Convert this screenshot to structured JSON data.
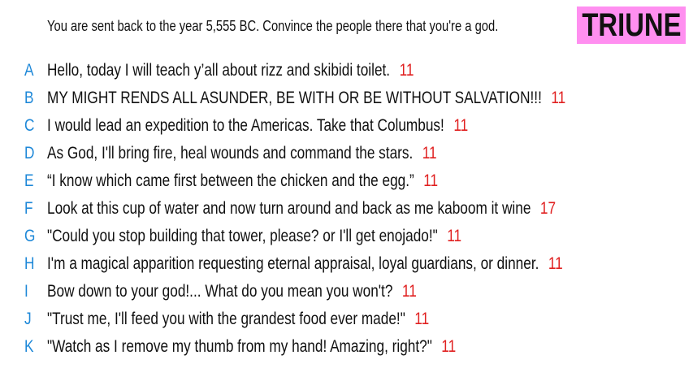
{
  "prompt": "You are sent back to the year 5,555 BC. Convince the people there that you're a god.",
  "badge": "TRIUNE",
  "colors": {
    "letter": "#1e88d8",
    "count": "#e02020",
    "badge_bg": "#ff8ff0"
  },
  "answers": [
    {
      "letter": "A",
      "text": "Hello, today I will teach y’all about rizz and skibidi toilet.",
      "count": "11"
    },
    {
      "letter": "B",
      "text": "MY MIGHT RENDS ALL ASUNDER, BE WITH OR BE WITHOUT SALVATION!!!",
      "count": "11"
    },
    {
      "letter": "C",
      "text": "I would lead an expedition to the Americas. Take that Columbus!",
      "count": "11"
    },
    {
      "letter": "D",
      "text": "As God, I'll bring fire, heal wounds and command the stars.",
      "count": "11"
    },
    {
      "letter": "E",
      "text": "“I know which came first between the chicken and the egg.”",
      "count": "11"
    },
    {
      "letter": "F",
      "text": "Look at this cup of water and now turn around and back as me kaboom it wine",
      "count": "17"
    },
    {
      "letter": "G",
      "text": "\"Could you stop building that tower, please? or I'll get enojado!\"",
      "count": "11"
    },
    {
      "letter": "H",
      "text": "I'm a magical apparition requesting eternal appraisal, loyal guardians, or dinner.",
      "count": "11"
    },
    {
      "letter": "I",
      "text": "Bow down to your god!... What do you mean you won't?",
      "count": "11"
    },
    {
      "letter": "J",
      "text": "\"Trust me, I'll feed you with the grandest food ever made!\"",
      "count": "11"
    },
    {
      "letter": "K",
      "text": "\"Watch as I remove my thumb from my hand! Amazing, right?\"",
      "count": "11"
    }
  ]
}
